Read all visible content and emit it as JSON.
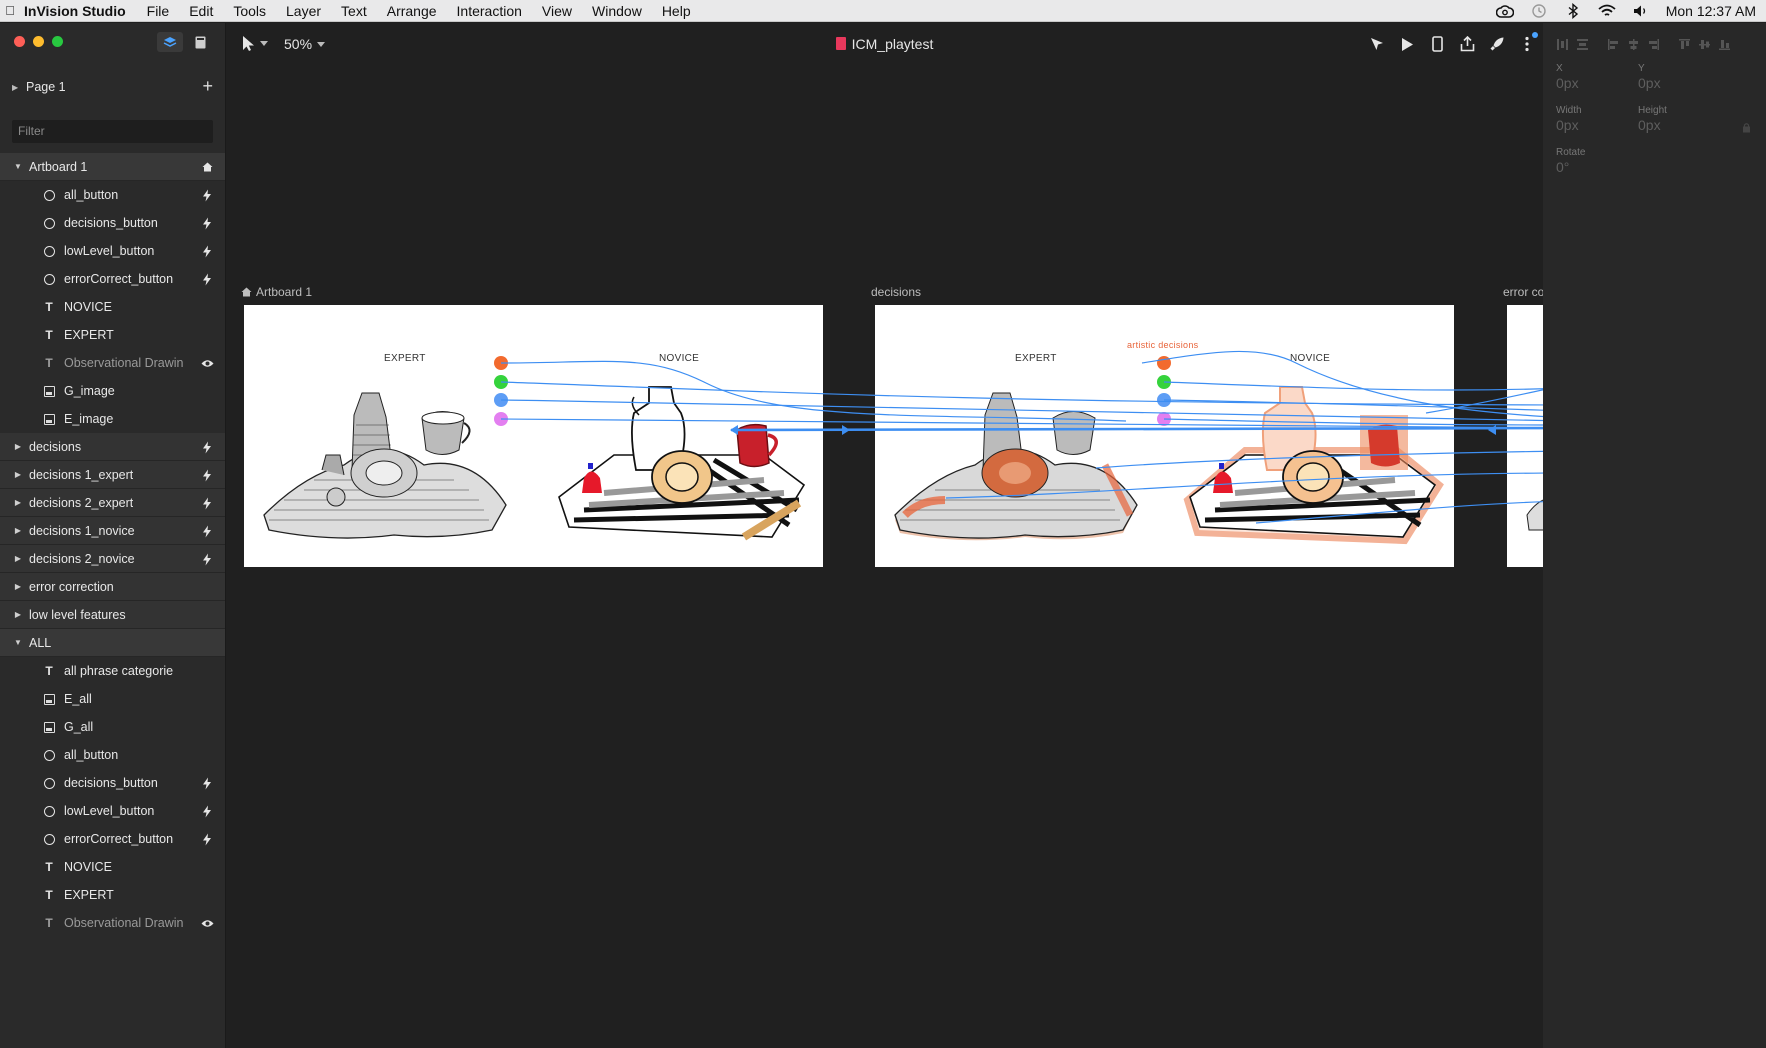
{
  "menubar": {
    "app_name": "InVision Studio",
    "items": [
      "File",
      "Edit",
      "Tools",
      "Layer",
      "Text",
      "Arrange",
      "Interaction",
      "View",
      "Window",
      "Help"
    ],
    "clock": "Mon 12:37 AM"
  },
  "sidebar": {
    "page_label": "Page 1",
    "filter_placeholder": "Filter",
    "layers": [
      {
        "label": "Artboard 1",
        "type": "group",
        "open": true,
        "action": "home-icon"
      },
      {
        "label": "all_button",
        "type": "ellipse",
        "action": "bolt-icon"
      },
      {
        "label": "decisions_button",
        "type": "ellipse",
        "action": "bolt-icon"
      },
      {
        "label": "lowLevel_button",
        "type": "ellipse",
        "action": "bolt-icon"
      },
      {
        "label": "errorCorrect_button",
        "type": "ellipse",
        "action": "bolt-icon"
      },
      {
        "label": "NOVICE",
        "type": "text"
      },
      {
        "label": "EXPERT",
        "type": "text"
      },
      {
        "label": "Observational Drawin",
        "type": "text",
        "dim": true,
        "action": "eye-icon"
      },
      {
        "label": "G_image",
        "type": "image"
      },
      {
        "label": "E_image",
        "type": "image"
      },
      {
        "label": "decisions",
        "type": "group",
        "action": "bolt-icon"
      },
      {
        "label": "decisions 1_expert",
        "type": "group",
        "action": "bolt-icon"
      },
      {
        "label": "decisions 2_expert",
        "type": "group",
        "action": "bolt-icon"
      },
      {
        "label": "decisions 1_novice",
        "type": "group",
        "action": "bolt-icon"
      },
      {
        "label": "decisions 2_novice",
        "type": "group",
        "action": "bolt-icon"
      },
      {
        "label": "error correction",
        "type": "group"
      },
      {
        "label": "low level features",
        "type": "group"
      },
      {
        "label": "ALL",
        "type": "group",
        "open": true
      },
      {
        "label": "all phrase categorie",
        "type": "text"
      },
      {
        "label": "E_all",
        "type": "image"
      },
      {
        "label": "G_all",
        "type": "image"
      },
      {
        "label": "all_button",
        "type": "ellipse"
      },
      {
        "label": "decisions_button",
        "type": "ellipse",
        "action": "bolt-icon"
      },
      {
        "label": "lowLevel_button",
        "type": "ellipse",
        "action": "bolt-icon"
      },
      {
        "label": "errorCorrect_button",
        "type": "ellipse",
        "action": "bolt-icon"
      },
      {
        "label": "NOVICE",
        "type": "text"
      },
      {
        "label": "EXPERT",
        "type": "text"
      },
      {
        "label": "Observational Drawin",
        "type": "text",
        "dim": true,
        "action": "eye-icon"
      }
    ]
  },
  "toolbar": {
    "zoom": "50%",
    "document_title": "ICM_playtest"
  },
  "canvas": {
    "artboards": [
      {
        "name": "Artboard 1",
        "expert_label": "EXPERT",
        "novice_label": "NOVICE"
      },
      {
        "name": "decisions",
        "expert_label": "EXPERT",
        "novice_label": "NOVICE",
        "annotation": "artistic decisions"
      },
      {
        "name": "error co"
      }
    ],
    "button_colors": [
      "#f26a2e",
      "#35d33c",
      "#5d9df5",
      "#e37ff0"
    ],
    "link_color": "#3d8ef2",
    "highlight_color": "#e8643a"
  },
  "inspector": {
    "x_label": "X",
    "x_value": "0px",
    "y_label": "Y",
    "y_value": "0px",
    "width_label": "Width",
    "width_value": "0px",
    "height_label": "Height",
    "height_value": "0px",
    "rotate_label": "Rotate",
    "rotate_value": "0°"
  }
}
